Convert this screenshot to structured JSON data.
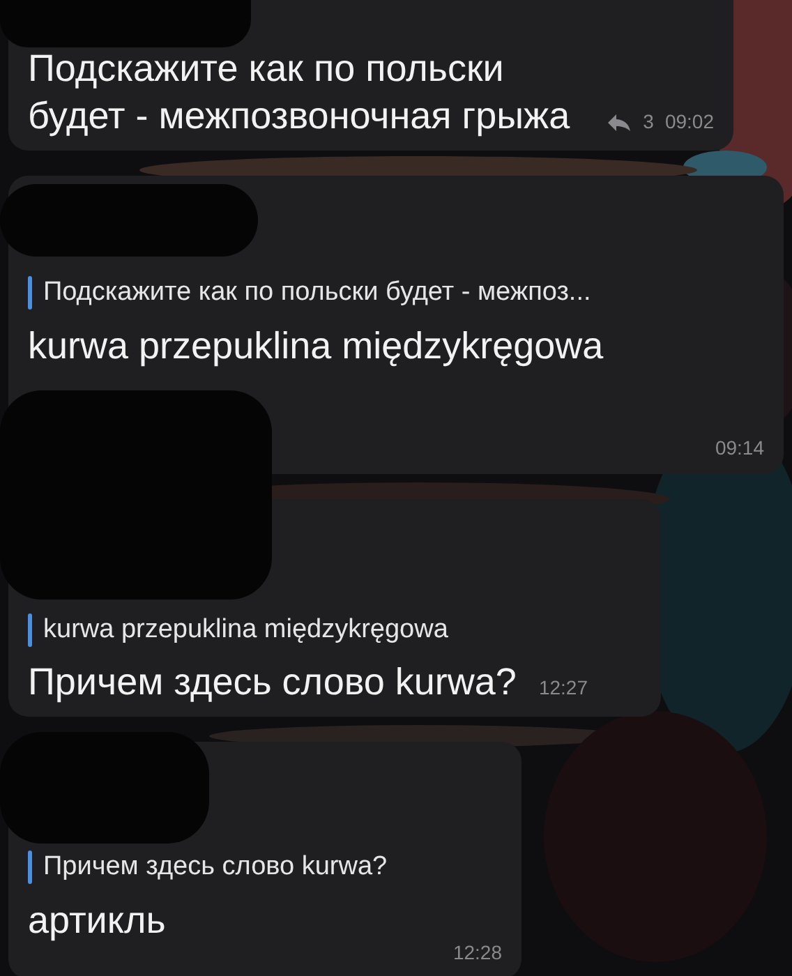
{
  "messages": [
    {
      "text": "Подскажите как по польски будет - межпозвоночная грыжа",
      "forward_count": "3",
      "time": "09:02"
    },
    {
      "quote": "Подскажите как по польски будет - межпоз...",
      "text": "kurwa przepuklina międzykręgowa",
      "time": "09:14"
    },
    {
      "quote": "kurwa przepuklina międzykręgowa",
      "text": "Причем здесь слово kurwa?",
      "time": "12:27"
    },
    {
      "quote": "Причем здесь слово kurwa?",
      "text": "артикль",
      "time": "12:28"
    }
  ]
}
